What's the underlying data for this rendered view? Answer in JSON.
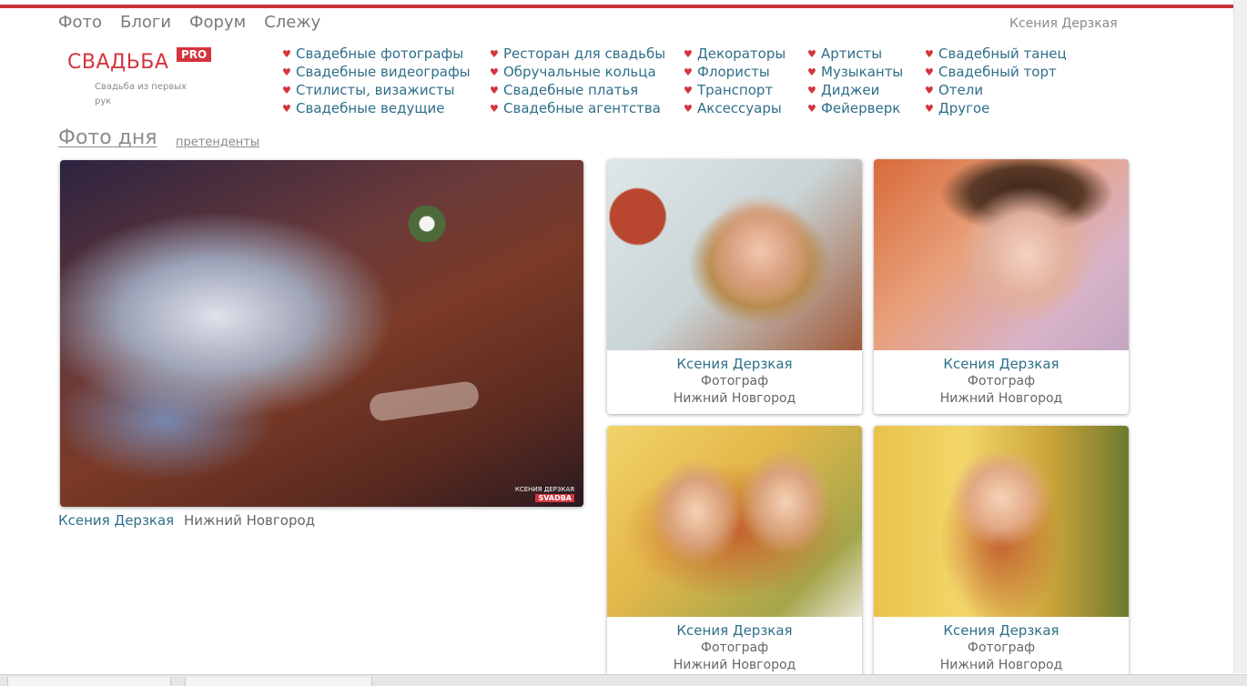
{
  "nav": {
    "items": [
      "Фото",
      "Блоги",
      "Форум",
      "Слежу"
    ],
    "user": "Ксения Дерзкая"
  },
  "logo": {
    "word": "СВАДЬБА",
    "badge": "PRO",
    "tagline": "Свадьба из первых рук"
  },
  "categories": [
    [
      "Свадебные фотографы",
      "Свадебные видеографы",
      "Стилисты, визажисты",
      "Свадебные ведущие"
    ],
    [
      "Ресторан для свадьбы",
      "Обручальные кольца",
      "Свадебные платья",
      "Свадебные агентства"
    ],
    [
      "Декораторы",
      "Флористы",
      "Транспорт",
      "Аксессуары"
    ],
    [
      "Артисты",
      "Музыканты",
      "Диджеи",
      "Фейерверк"
    ],
    [
      "Свадебный танец",
      "Свадебный торт",
      "Отели",
      "Другое"
    ]
  ],
  "photo_of_day": {
    "title": "Фото дня",
    "contenders_link": "претенденты",
    "featured": {
      "author": "Ксения Дерзкая",
      "city": "Нижний Новгород",
      "watermark_name": "КСЕНИЯ ДЕРЗКАЯ",
      "watermark_badge": "SVADBA"
    },
    "cards": [
      {
        "name": "Ксения Дерзкая",
        "role": "Фотограф",
        "city": "Нижний Новгород"
      },
      {
        "name": "Ксения Дерзкая",
        "role": "Фотограф",
        "city": "Нижний Новгород"
      },
      {
        "name": "Ксения Дерзкая",
        "role": "Фотограф",
        "city": "Нижний Новгород"
      },
      {
        "name": "Ксения Дерзкая",
        "role": "Фотограф",
        "city": "Нижний Новгород"
      }
    ]
  },
  "colors": {
    "accent": "#d4343e",
    "link": "#2f6f8a"
  }
}
